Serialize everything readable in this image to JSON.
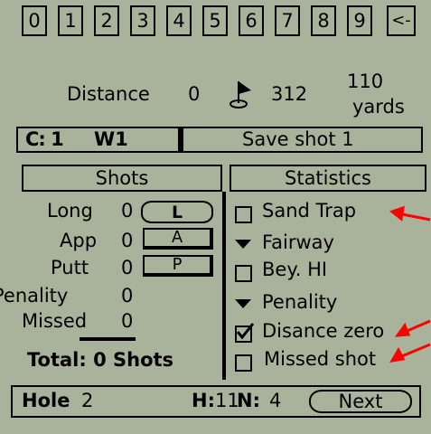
{
  "keypad": {
    "keys": [
      "0",
      "1",
      "2",
      "3",
      "4",
      "5",
      "6",
      "7",
      "8",
      "9"
    ],
    "back": "<-"
  },
  "distance": {
    "label": "Distance",
    "value": "0",
    "pin_value": "312",
    "remaining": "110",
    "unit": "yards"
  },
  "shot_bar": {
    "club_prefix": "C: 1",
    "club": "W1",
    "save_label": "Save shot 1"
  },
  "shots": {
    "header": "Shots",
    "rows": [
      {
        "label": "Long",
        "value": "0",
        "button": "L"
      },
      {
        "label": "App",
        "value": "0",
        "button": "A"
      },
      {
        "label": "Putt",
        "value": "0",
        "button": "P"
      },
      {
        "label": "Penality",
        "value": "0"
      },
      {
        "label": "Missed",
        "value": "0"
      }
    ],
    "total": "Total: 0 Shots"
  },
  "statistics": {
    "header": "Statistics",
    "sand_trap": "Sand Trap",
    "fairway": "Fairway",
    "bey_hi": "Bey. HI",
    "penality": "Penality",
    "distance_zero": "Disance zero",
    "missed_shot": "Missed shot",
    "sand_trap_checked": false,
    "bey_hi_checked": false,
    "distance_zero_checked": true,
    "missed_shot_checked": false
  },
  "footer": {
    "hole_label": "Hole",
    "hole_number": "2",
    "h_label": "H:",
    "h_value": "11",
    "n_label": "N:",
    "n_value": "4",
    "next_label": "Next"
  },
  "colors": {
    "screen": "#a9b29a",
    "ink": "#000000",
    "annotation_arrow": "#ff0000"
  }
}
